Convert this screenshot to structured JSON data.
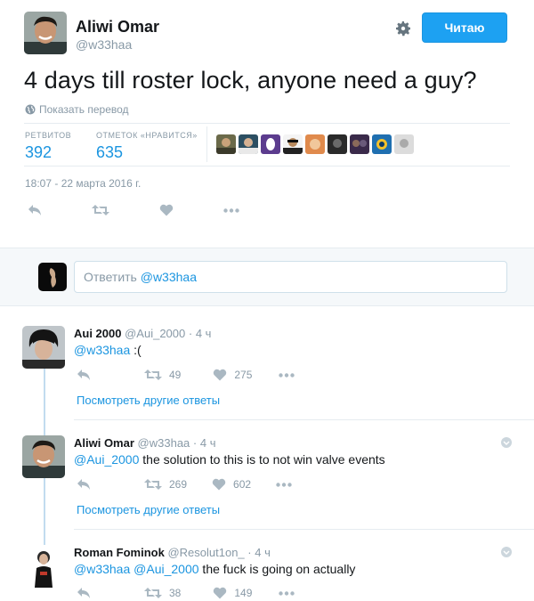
{
  "tweet": {
    "author_name": "Aliwi Omar",
    "author_handle": "@w33haa",
    "follow_label": "Читаю",
    "text": "4 days till roster lock, anyone need a guy?",
    "translate_label": "Показать перевод",
    "retweets_label": "РЕТВИТОВ",
    "retweets_count": "392",
    "likes_label": "ОТМЕТОК «НРАВИТСЯ»",
    "likes_count": "635",
    "timestamp": "18:07 - 22 марта 2016 г."
  },
  "reply_box": {
    "placeholder_prefix": "Ответить ",
    "placeholder_mention": "@w33haa"
  },
  "replies": [
    {
      "name": "Aui 2000",
      "handle": "@Aui_2000",
      "time": "· 4 ч",
      "text_mention": "@w33haa",
      "text_rest": " :(",
      "retweets": "49",
      "likes": "275",
      "more_label": "Посмотреть другие ответы"
    },
    {
      "name": "Aliwi Omar",
      "handle": "@w33haa",
      "time": "· 4 ч",
      "text_mention": "@Aui_2000",
      "text_rest": " the solution to this is to not win valve events",
      "retweets": "269",
      "likes": "602",
      "more_label": "Посмотреть другие ответы"
    },
    {
      "name": "Roman Fominok",
      "handle": "@Resolut1on_",
      "time": "· 4 ч",
      "text_mention": "@w33haa",
      "text_mention2": "@Aui_2000",
      "text_rest": " the fuck is going on actually",
      "retweets": "38",
      "likes": "149"
    }
  ],
  "icons": {
    "reply": "reply-icon",
    "retweet": "retweet-icon",
    "like": "heart-icon",
    "more": "more-icon",
    "gear": "gear-icon",
    "globe": "globe-icon"
  },
  "colors": {
    "accent": "#1da1f2",
    "link": "#1b95e0",
    "muted": "#8899a6"
  }
}
